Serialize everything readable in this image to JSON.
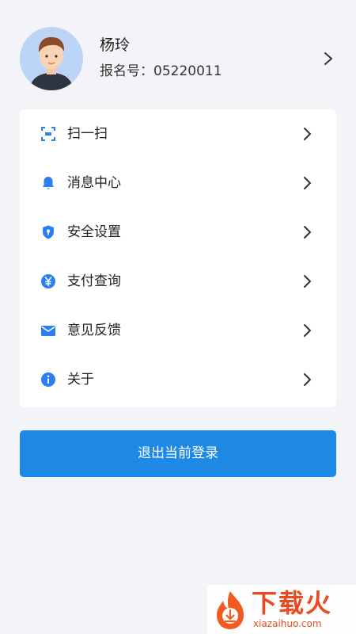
{
  "profile": {
    "name": "杨玲",
    "id_label": "报名号：05220011"
  },
  "menu": {
    "items": [
      {
        "label": "扫一扫",
        "icon": "scan-icon"
      },
      {
        "label": "消息中心",
        "icon": "bell-icon"
      },
      {
        "label": "安全设置",
        "icon": "shield-icon"
      },
      {
        "label": "支付查询",
        "icon": "yen-icon"
      },
      {
        "label": "意见反馈",
        "icon": "mail-icon"
      },
      {
        "label": "关于",
        "icon": "info-icon"
      }
    ]
  },
  "logout": {
    "label": "退出当前登录"
  },
  "watermark": {
    "title": "下载火",
    "subtitle": "xiazaihuo.com"
  },
  "colors": {
    "background": "#f3f4f8",
    "accent": "#1e88e5",
    "icon": "#2d7ff0",
    "watermark": "#e94a1f"
  }
}
